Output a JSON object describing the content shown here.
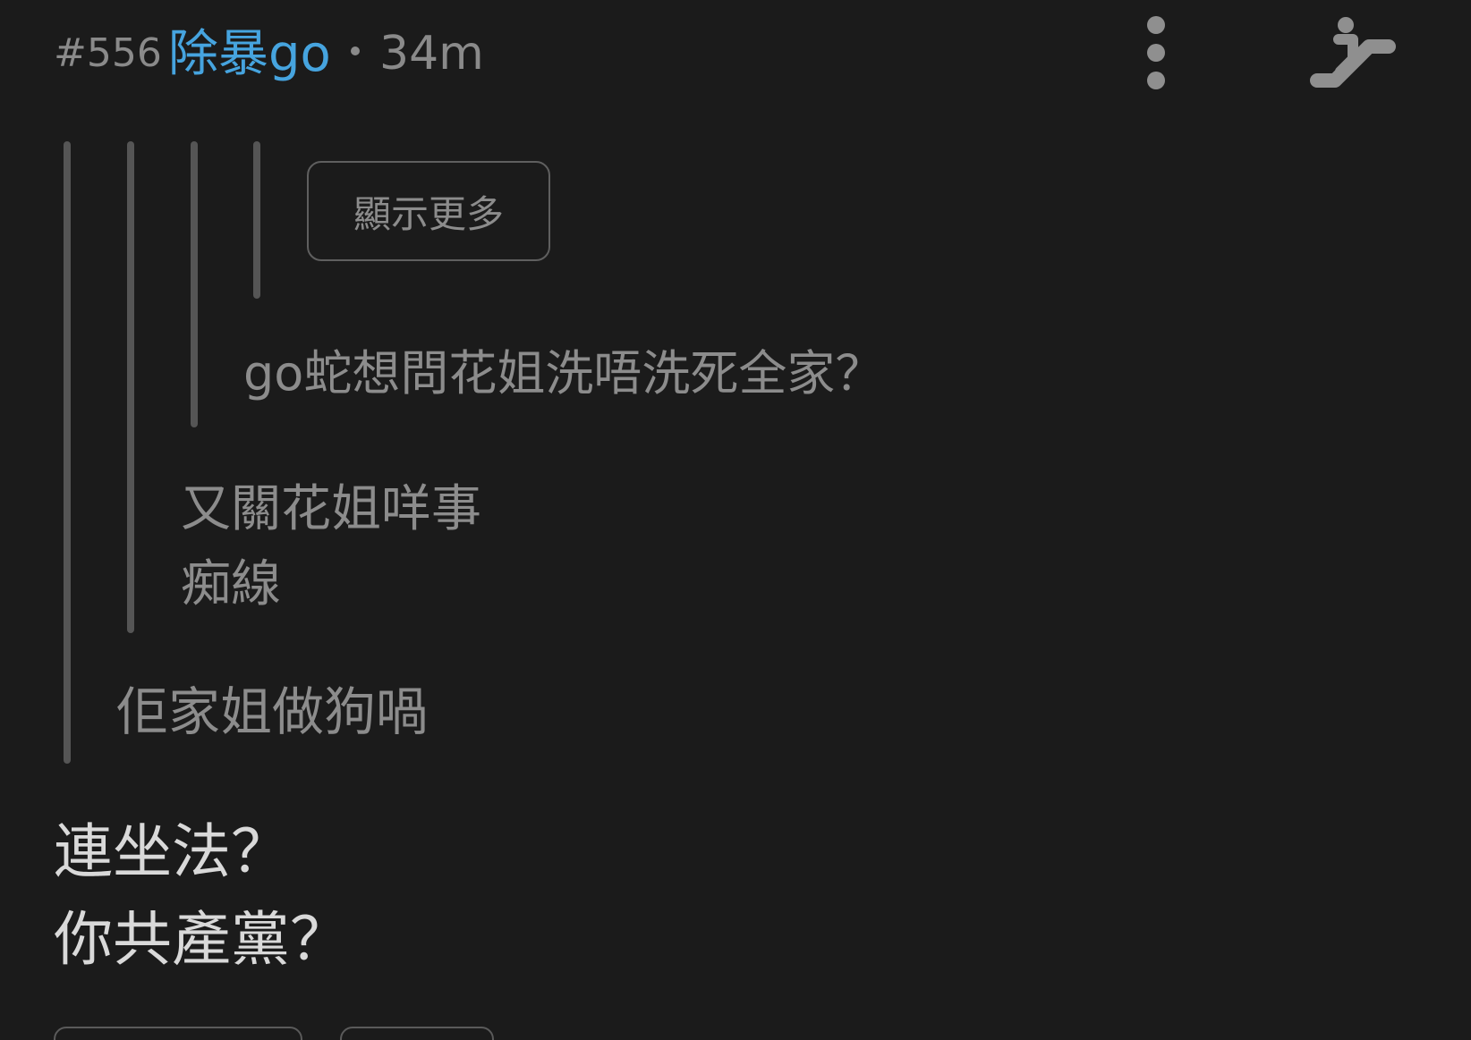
{
  "post": {
    "number": "#556",
    "username": "除暴go",
    "time": "34m"
  },
  "icons": {
    "more": "more-vertical-icon",
    "escalator": "escalator-icon"
  },
  "thread": {
    "show_more_label": "顯示更多",
    "quote_level4": "go蛇想問花姐洗唔洗死全家？",
    "quote_level3_lines": [
      "又關花姐咩事",
      "痴線"
    ],
    "quote_level2": "佢家姐做狗喎"
  },
  "reply": {
    "lines": [
      "連坐法？",
      "你共產黨？"
    ]
  },
  "colors": {
    "background": "#1b1b1b",
    "username": "#46a4df",
    "muted_text": "#8c8c8c",
    "body_text": "#d9d9d9",
    "quote_bar": "#555555"
  }
}
